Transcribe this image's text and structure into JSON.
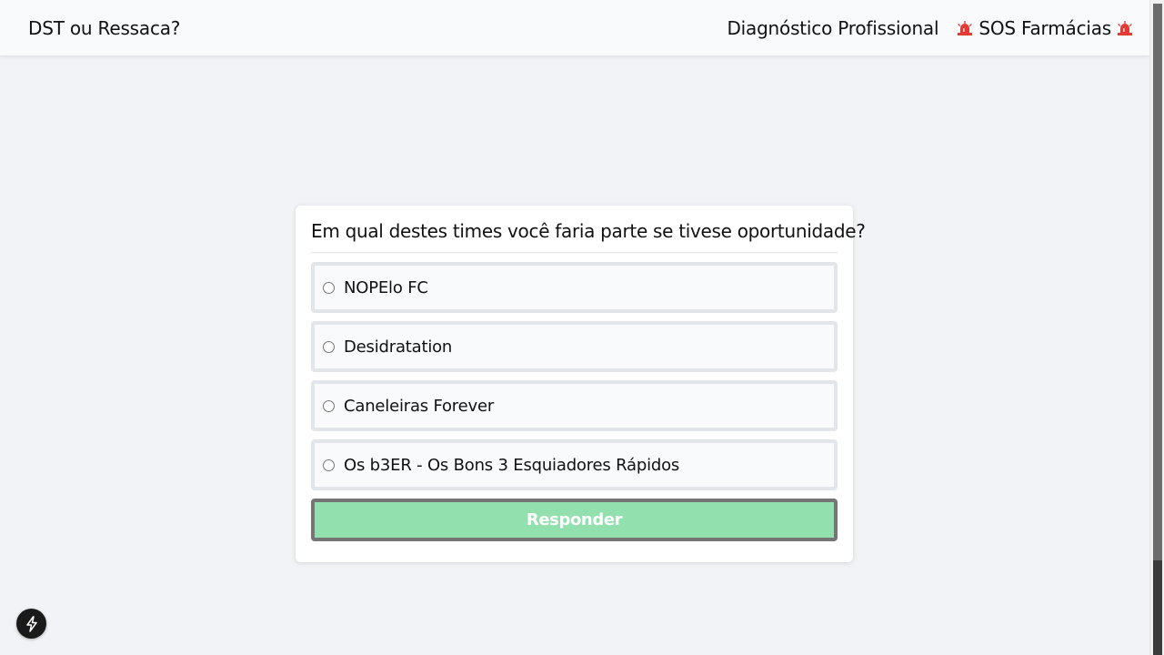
{
  "navbar": {
    "brand": "DST ou Ressaca?",
    "links": {
      "diagnostico": "Diagnóstico Profissional",
      "sos": "SOS Farmácias"
    }
  },
  "quiz": {
    "question": "Em qual destes times você faria parte se tivese oportunidade?",
    "options": [
      "NOPElo FC",
      "Desidratation",
      "Caneleiras Forever",
      "Os b3ER - Os Bons 3 Esquiadores Rápidos"
    ],
    "submit_label": "Responder"
  },
  "icons": {
    "siren": "siren-icon",
    "fab": "lightning-icon"
  },
  "colors": {
    "submit_bg": "#91e0ad",
    "siren": "#e53935"
  }
}
